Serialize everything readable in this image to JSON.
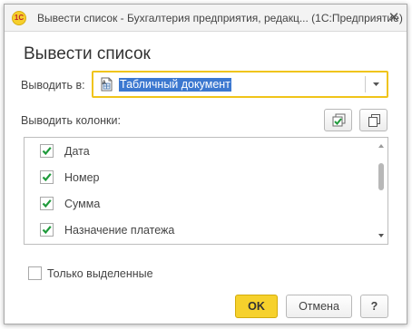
{
  "window": {
    "app_logo_text": "1С",
    "title": "Вывести список - Бухгалтерия предприятия, редакц... (1С:Предприятие)",
    "close_icon": "close-icon"
  },
  "heading": "Вывести список",
  "output_to": {
    "label": "Выводить в:",
    "value": "Табличный документ",
    "value_icon": "spreadsheet-document-icon"
  },
  "columns": {
    "label": "Выводить колонки:",
    "check_all_icon": "check-all-icon",
    "copy_icon": "copy-icon",
    "items": [
      {
        "label": "Дата",
        "checked": true
      },
      {
        "label": "Номер",
        "checked": true
      },
      {
        "label": "Сумма",
        "checked": true
      },
      {
        "label": "Назначение платежа",
        "checked": true
      }
    ]
  },
  "only_selected": {
    "label": "Только выделенные",
    "checked": false
  },
  "buttons": {
    "ok": "OK",
    "cancel": "Отмена",
    "help": "?"
  },
  "colors": {
    "accent": "#f6d12c",
    "focus_border": "#f0c419",
    "selection": "#3c78d0",
    "check": "#1f9a3b"
  }
}
